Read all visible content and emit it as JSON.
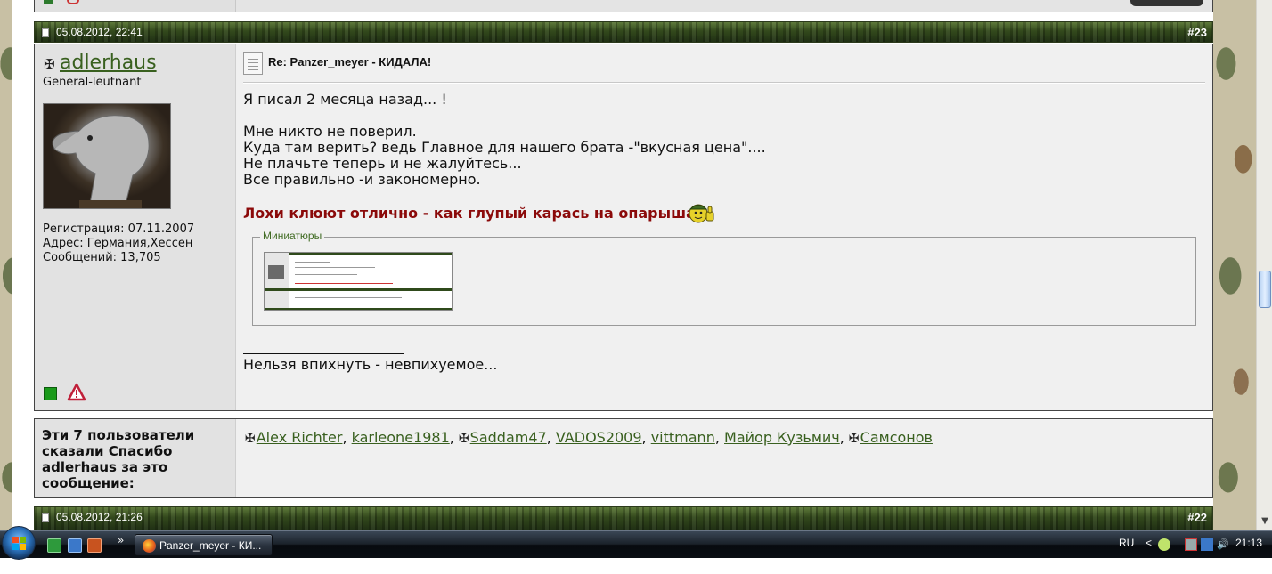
{
  "post": {
    "date": "05.08.2012, 22:41",
    "number": "#23",
    "user": {
      "name": "adlerhaus",
      "rank": "General-leutnant",
      "registration": "Регистрация: 07.11.2007",
      "address": "Адрес: Германия,Хессен",
      "posts": "Сообщений: 13,705"
    },
    "title": "Re: Panzer_meyer - КИДАЛА!",
    "lines": [
      "Я писал 2 месяца назад... !",
      "Мне никто не поверил.",
      "Куда там верить? ведь Главное для нашего брата -\"вкусная цена\"....",
      "Не плачьте теперь и не жалуйтесь...",
      "Все правильно -и закономерно."
    ],
    "highlight": "Лохи клюют отлично - как глупый карась на опарыша",
    "thumbnails_label": "Миниатюры",
    "signature": "Нельзя впихнуть - невпихуемое..."
  },
  "thanks": {
    "label": "Эти 7 пользователи сказали Спасибо adlerhaus за это сообщение:",
    "users": [
      "Alex Richter",
      "karleone1981",
      "Saddam47",
      "VADOS2009",
      "vittmann",
      "Майор Кузьмич",
      "Самсонов"
    ]
  },
  "next_post": {
    "date": "05.08.2012, 21:26",
    "number": "#22"
  },
  "taskbar": {
    "overflow": "»",
    "task_title": "Panzer_meyer - КИ...",
    "lang": "RU",
    "tray_arrow": "<",
    "clock": "21:13"
  },
  "colors": {
    "header_green": "#33491c",
    "link_green": "#39601f",
    "highlight_red": "#8b0a0a"
  }
}
